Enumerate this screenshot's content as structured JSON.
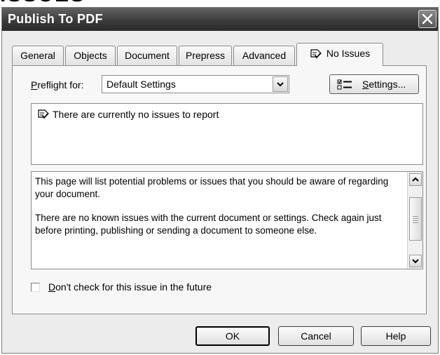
{
  "window": {
    "title": "Publish To PDF",
    "title_overflow_text": "ISSUES"
  },
  "tabs": [
    {
      "label": "General",
      "active": false
    },
    {
      "label": "Objects",
      "active": false
    },
    {
      "label": "Document",
      "active": false
    },
    {
      "label": "Prepress",
      "active": false
    },
    {
      "label": "Advanced",
      "active": false
    },
    {
      "label": "No Issues",
      "active": true,
      "icon": "check-document-icon"
    }
  ],
  "preflight": {
    "label_accel": "P",
    "label_rest": "reflight for:",
    "selected": "Default Settings",
    "settings_button_accel": "S",
    "settings_button_rest": "ettings..."
  },
  "issues": {
    "message": "There are currently no issues to report"
  },
  "description": {
    "paragraph1": "This page will list potential problems or issues that you should be aware of regarding your document.",
    "paragraph2": "There are no known issues with the current document or settings. Check again just before printing, publishing or sending a document to someone else."
  },
  "dont_check": {
    "label_accel": "D",
    "label_rest": "on't check for this issue in the future",
    "checked": false
  },
  "buttons": {
    "ok": "OK",
    "cancel": "Cancel",
    "help": "Help"
  }
}
